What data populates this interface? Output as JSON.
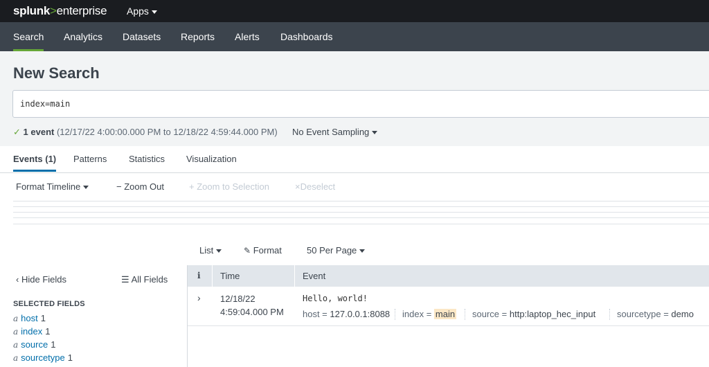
{
  "app": {
    "logo_main": "splunk",
    "logo_gt": ">",
    "logo_sub": "enterprise",
    "apps_menu": "Apps"
  },
  "nav": {
    "items": [
      "Search",
      "Analytics",
      "Datasets",
      "Reports",
      "Alerts",
      "Dashboards"
    ],
    "active": "Search"
  },
  "page": {
    "title": "New Search"
  },
  "search": {
    "query": "index=main"
  },
  "status": {
    "check": "✓",
    "count": "1 event",
    "range": "(12/17/22 4:00:00.000 PM to 12/18/22 4:59:44.000 PM)",
    "sampling": "No Event Sampling"
  },
  "tabs": [
    "Events (1)",
    "Patterns",
    "Statistics",
    "Visualization"
  ],
  "timeline": {
    "format": "Format Timeline",
    "zoom_out": "Zoom Out",
    "zoom_sel": "Zoom to Selection",
    "deselect": "Deselect"
  },
  "results_bar": {
    "list": "List",
    "format": "Format",
    "per_page": "50 Per Page"
  },
  "fields": {
    "hide": "Hide Fields",
    "all": "All Fields",
    "selected_title": "SELECTED FIELDS",
    "type_glyph": "a",
    "items": [
      {
        "name": "host",
        "count": "1"
      },
      {
        "name": "index",
        "count": "1"
      },
      {
        "name": "source",
        "count": "1"
      },
      {
        "name": "sourcetype",
        "count": "1"
      }
    ]
  },
  "events_table": {
    "headers": {
      "info": "i",
      "time": "Time",
      "event": "Event"
    },
    "rows": [
      {
        "date": "12/18/22",
        "time": "4:59:04.000 PM",
        "raw": "Hello, world!",
        "host_key": "host =",
        "host_val": "127.0.0.1:8088",
        "index_key": "index =",
        "index_val": "main",
        "source_key": "source =",
        "source_val": "http:laptop_hec_input",
        "sourcetype_key": "sourcetype =",
        "sourcetype_val": "demo"
      }
    ]
  },
  "colors": {
    "accent_green": "#65a637",
    "accent_blue": "#006eaa",
    "topbar": "#1a1c20",
    "navbar": "#3c444d"
  }
}
